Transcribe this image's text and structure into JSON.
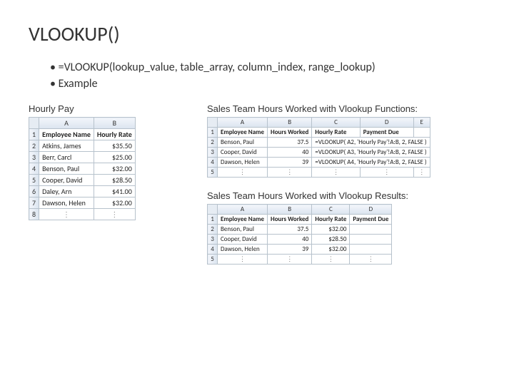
{
  "title": "VLOOKUP()",
  "bullets": {
    "syntax": "=VLOOKUP(lookup_value, table_array, column_index, range_lookup)",
    "example": "Example"
  },
  "left": {
    "label": "Hourly Pay",
    "cols": {
      "A": "A",
      "B": "B"
    },
    "header": {
      "name": "Employee Name",
      "rate": "Hourly Rate"
    },
    "rows": [
      {
        "n": "1",
        "name": "Atkins, James",
        "rate": "$35.50"
      },
      {
        "n": "2",
        "name": "Berr, Carcl",
        "rate": "$25.00"
      },
      {
        "n": "3",
        "name": "Benson, Paul",
        "rate": "$32.00"
      },
      {
        "n": "4",
        "name": "Cooper, David",
        "rate": "$28.50"
      },
      {
        "n": "5",
        "name": "Daley, Arn",
        "rate": "$41.00"
      },
      {
        "n": "6",
        "name": "Dawson, Helen",
        "rate": "$32.00"
      }
    ],
    "lastrow": "8"
  },
  "right1": {
    "label": "Sales Team Hours Worked with Vlookup Functions:",
    "cols": {
      "A": "A",
      "B": "B",
      "C": "C",
      "D": "D",
      "E": "E"
    },
    "header": {
      "name": "Employee Name",
      "hours": "Hours Worked",
      "rate": "Hourly Rate",
      "due": "Payment Due"
    },
    "rows": [
      {
        "n": "2",
        "name": "Benson, Paul",
        "hours": "37.5",
        "formula": "=VLOOKUP( A2, 'Hourly Pay'!A:B, 2, FALSE )"
      },
      {
        "n": "3",
        "name": "Cooper, David",
        "hours": "40",
        "formula": "=VLOOKUP( A3, 'Hourly Pay'!A:B, 2, FALSE )"
      },
      {
        "n": "4",
        "name": "Dawson, Helen",
        "hours": "39",
        "formula": "=VLOOKUP( A4, 'Hourly Pay'!A:B, 2, FALSE )"
      }
    ],
    "lastrow": "5"
  },
  "right2": {
    "label": "Sales Team Hours Worked with Vlookup Results:",
    "cols": {
      "A": "A",
      "B": "B",
      "C": "C",
      "D": "D"
    },
    "header": {
      "name": "Employee Name",
      "hours": "Hours Worked",
      "rate": "Hourly Rate",
      "due": "Payment Due"
    },
    "rows": [
      {
        "n": "2",
        "name": "Benson, Paul",
        "hours": "37.5",
        "rate": "$32.00"
      },
      {
        "n": "3",
        "name": "Cooper, David",
        "hours": "40",
        "rate": "$28.50"
      },
      {
        "n": "4",
        "name": "Dawson, Helen",
        "hours": "39",
        "rate": "$32.00"
      }
    ],
    "lastrow": "5"
  },
  "dots": "⋮"
}
